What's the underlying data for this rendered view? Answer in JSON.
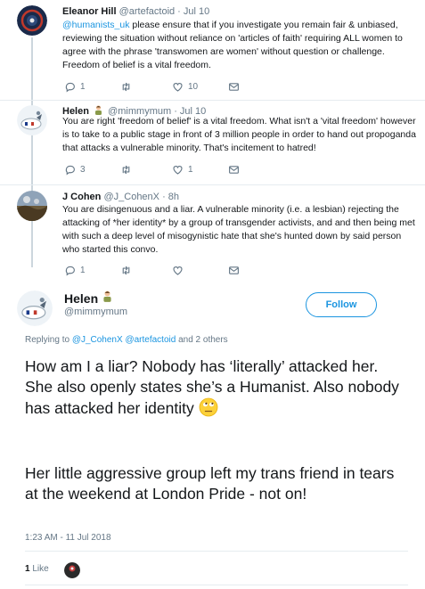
{
  "replies": [
    {
      "name": "Eleanor Hill",
      "handle": "@artefactoid",
      "time": "Jul 10",
      "mention": "@humanists_uk",
      "text": " please ensure that if you investigate you remain fair & unbiased, reviewing the situation without reliance on 'articles of faith' requiring ALL women to agree with the phrase 'transwomen are women' without question or challenge. Freedom of belief is a vital freedom.",
      "reply_count": "1",
      "retweet_count": "",
      "like_count": "10"
    },
    {
      "name": "Helen",
      "handle": "@mimmymum",
      "time": "Jul 10",
      "text": "You are right 'freedom of belief' is a vital freedom. What isn't a 'vital freedom' however is to take to a public stage in front of 3 million people in order to hand out propoganda that attacks a vulnerable minority. That's incitement to hatred!",
      "reply_count": "3",
      "retweet_count": "",
      "like_count": "1"
    },
    {
      "name": "J Cohen",
      "handle": "@J_CohenX",
      "time": "8h",
      "text": "You are disingenuous and a liar. A vulnerable minority (i.e. a lesbian) rejecting the attacking of *her identity* by a group of transgender activists, and and then being met with such a deep level of misogynistic hate that she's hunted down by said person who started this convo.",
      "reply_count": "1",
      "retweet_count": "",
      "like_count": ""
    }
  ],
  "main": {
    "name": "Helen",
    "handle": "@mimmymum",
    "follow_label": "Follow",
    "replying_prefix": "Replying to ",
    "replying_mentions": "@J_CohenX @artefactoid",
    "replying_suffix": " and 2 others",
    "paragraph1": "How am I a liar? Nobody has ‘literally’ attacked her. She also openly states she’s a Humanist. Also nobody has attacked her identity",
    "paragraph2": "Her little aggressive group left my trans friend in tears at the weekend at London Pride - not on!",
    "timestamp": "1:23 AM - 11 Jul 2018",
    "like_count": "1",
    "like_label": " Like"
  },
  "separator": " · ",
  "colors": {
    "link": "#1b95e0",
    "muted": "#657786",
    "text": "#14171a",
    "line": "#ccd6dd"
  },
  "icons": [
    "reply-icon",
    "retweet-icon",
    "heart-icon",
    "message-icon",
    "rolling-eyes-emoji",
    "follow-button"
  ]
}
